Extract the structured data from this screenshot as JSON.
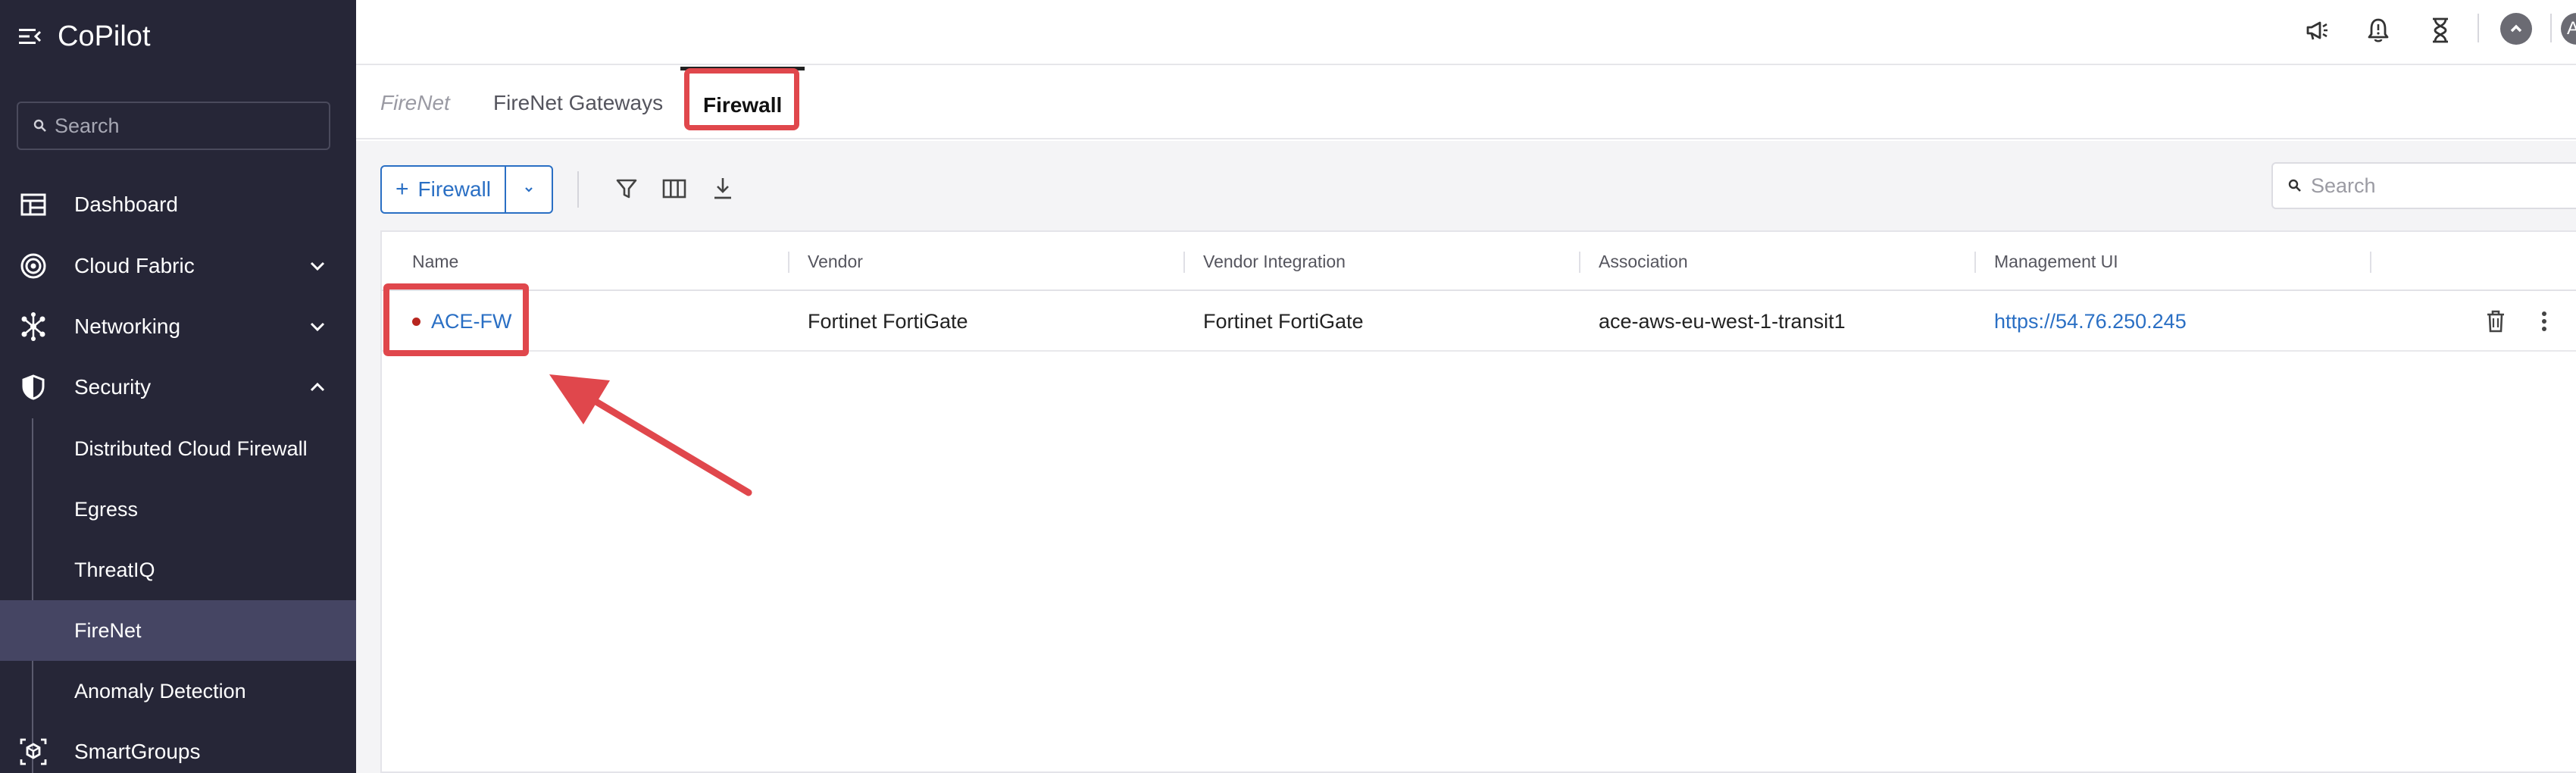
{
  "app": {
    "title": "CoPilot"
  },
  "sidebar": {
    "search_placeholder": "Search",
    "items": [
      {
        "label": "Dashboard",
        "icon": "dashboard-icon"
      },
      {
        "label": "Cloud Fabric",
        "icon": "cloud-fabric-icon",
        "expanded": false
      },
      {
        "label": "Networking",
        "icon": "networking-icon",
        "expanded": false
      },
      {
        "label": "Security",
        "icon": "shield-icon",
        "expanded": true
      }
    ],
    "security_subitems": [
      {
        "label": "Distributed Cloud Firewall"
      },
      {
        "label": "Egress"
      },
      {
        "label": "ThreatIQ"
      },
      {
        "label": "FireNet",
        "active": true
      },
      {
        "label": "Anomaly Detection"
      }
    ],
    "smartgroups": {
      "label": "SmartGroups",
      "icon": "smartgroups-icon"
    }
  },
  "topbar": {
    "icons": [
      "megaphone-icon",
      "bell-icon",
      "hourglass-icon",
      "upgrade-icon",
      "avatar"
    ],
    "avatar_initial": "A"
  },
  "tabs": [
    {
      "label": "FireNet",
      "state": "muted"
    },
    {
      "label": "FireNet Gateways",
      "state": "normal"
    },
    {
      "label": "Firewall",
      "state": "active"
    }
  ],
  "toolbar": {
    "add_label": "Firewall",
    "search_placeholder": "Search"
  },
  "table": {
    "columns": [
      "Name",
      "Vendor",
      "Vendor Integration",
      "Association",
      "Management UI"
    ],
    "rows": [
      {
        "name": "ACE-FW",
        "status_color": "#b8261f",
        "vendor": "Fortinet FortiGate",
        "vendor_integration": "Fortinet FortiGate",
        "association": "ace-aws-eu-west-1-transit1",
        "management_ui": "https://54.76.250.245"
      }
    ]
  },
  "colors": {
    "sidebar_bg": "#262637",
    "sidebar_active": "#454563",
    "accent_blue": "#2a6fc4",
    "annotation_red": "#e0474c"
  }
}
